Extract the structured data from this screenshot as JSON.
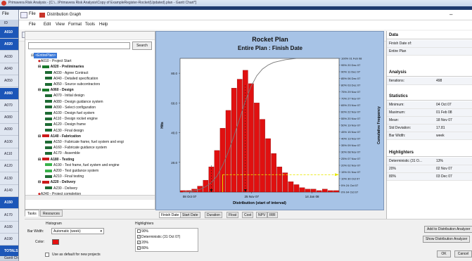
{
  "outer_title": "Primavera Risk Analysis - [C:\\...\\Primavera Risk Analysis\\Copy of ExampleRegister-Rocket(Updated).plan - Gantt Chart*]",
  "window": {
    "title": "Distribution Graph",
    "minimize": "–"
  },
  "menu": [
    "File",
    "Edit",
    "View",
    "Format",
    "Tools",
    "Help"
  ],
  "outer_tabs": {
    "file": "File"
  },
  "strip": {
    "header": "ID",
    "rows": [
      "A010",
      "A020",
      "A030",
      "A040",
      "A050",
      "A060",
      "A070",
      "A080",
      "A090",
      "A100",
      "A110",
      "A120",
      "A130",
      "A140",
      "A150",
      "A170",
      "A180",
      "A190",
      "TOTALS"
    ],
    "bottom_tab": "Gantt Ch"
  },
  "search": {
    "button": "Search",
    "value": ""
  },
  "tree": [
    {
      "label": "<EntirePlan>",
      "level": 0,
      "kind": "root"
    },
    {
      "label": "A010 - Project Start",
      "level": 1,
      "kind": "milestone"
    },
    {
      "label": "A020 - Preliminaries",
      "level": 1,
      "kind": "summary"
    },
    {
      "label": "A030 - Agree Contract",
      "level": 2,
      "kind": "task"
    },
    {
      "label": "A040 - Detailed specification",
      "level": 2,
      "kind": "task"
    },
    {
      "label": "A050 - Source subcontractors",
      "level": 2,
      "kind": "task"
    },
    {
      "label": "A060 - Design",
      "level": 1,
      "kind": "summary"
    },
    {
      "label": "A070 - Initial design",
      "level": 2,
      "kind": "task"
    },
    {
      "label": "A080 - Design guidance system",
      "level": 2,
      "kind": "task"
    },
    {
      "label": "A090 - Select configuration",
      "level": 2,
      "kind": "task"
    },
    {
      "label": "A100 - Design fuel system",
      "level": 2,
      "kind": "task"
    },
    {
      "label": "A110 - Design rocket engine",
      "level": 2,
      "kind": "task"
    },
    {
      "label": "A120 - Design frame",
      "level": 2,
      "kind": "task"
    },
    {
      "label": "A130 - Final design",
      "level": 2,
      "kind": "task"
    },
    {
      "label": "A140 - Fabrication",
      "level": 1,
      "kind": "summary-red"
    },
    {
      "label": "A150 - Fabricate frame, fuel system and engi",
      "level": 2,
      "kind": "task"
    },
    {
      "label": "A160 - Fabricate guidance system",
      "level": 2,
      "kind": "task"
    },
    {
      "label": "A170 - Assemble",
      "level": 2,
      "kind": "task"
    },
    {
      "label": "A180 - Testing",
      "level": 1,
      "kind": "summary-red"
    },
    {
      "label": "A190 - Test frame, fuel system and engine",
      "level": 2,
      "kind": "task-g"
    },
    {
      "label": "A200 - Test guidance system",
      "level": 2,
      "kind": "task-g"
    },
    {
      "label": "A210 - Final testing",
      "level": 2,
      "kind": "task"
    },
    {
      "label": "A220 - Delivery",
      "level": 1,
      "kind": "summary-red"
    },
    {
      "label": "A230 - Delivery",
      "level": 2,
      "kind": "task"
    },
    {
      "label": "A240 - Project completion",
      "level": 1,
      "kind": "milestone"
    }
  ],
  "panel_tabs": [
    "Tasks",
    "Resources"
  ],
  "chart_tabs": [
    "Finish Date",
    "Start Date",
    "Duration",
    "Float",
    "Cost",
    "NPV",
    "IRR"
  ],
  "colors": {
    "bar": "#e01010",
    "plot_bg": "#ffffff",
    "frame_bg": "#a7c3e6",
    "cum_line": "#777777",
    "highlight": "#e8e800"
  },
  "chart_data": {
    "type": "bar",
    "title": "Rocket Plan",
    "subtitle": "Entire Plan : Finish Date",
    "xlabel": "Distribution (start of interval)",
    "ylabel": "Hits",
    "y2label": "Cumulative Frequency",
    "ylim": [
      0,
      90
    ],
    "yticks": [
      "80.0",
      "60.0",
      "40.0",
      "20.0"
    ],
    "xticks": [
      "08 Oct 07",
      "25 Nov 07",
      "14 Jan 08"
    ],
    "values": [
      1,
      1,
      2,
      4,
      8,
      17,
      28,
      43,
      55,
      70,
      76,
      82,
      73,
      60,
      49,
      36,
      26,
      17,
      13,
      7,
      5,
      3,
      2,
      2,
      1,
      2,
      1,
      1
    ],
    "cumulative": [
      0,
      0,
      0.01,
      0.02,
      0.04,
      0.07,
      0.12,
      0.2,
      0.3,
      0.42,
      0.55,
      0.68,
      0.79,
      0.87,
      0.92,
      0.95,
      0.97,
      0.98,
      0.99,
      0.995,
      1,
      1,
      1,
      1,
      1,
      1,
      1,
      1
    ],
    "right_axis": [
      "100% 01 Feb 08",
      "95% 20 Dec 07",
      "90% 11 Dec 07",
      "85% 06 Dec 07",
      "80% 03 Dec 07",
      "75% 29 Nov 07",
      "70% 27 Nov 07",
      "65% 23 Nov 07",
      "60% 22 Nov 07",
      "55% 20 Nov 07",
      "50% 19 Nov 07",
      "45% 15 Nov 07",
      "40% 13 Nov 07",
      "35% 09 Nov 07",
      "30% 08 Nov 07",
      "25% 07 Nov 07",
      "20% 02 Nov 07",
      "15% 01 Nov 07",
      "10% 30 Oct 07",
      "5% 24 Oct 07",
      "0% 04 Oct 07"
    ]
  },
  "stats": {
    "data_h": "Data",
    "data": [
      [
        "Finish Date of:",
        ""
      ],
      [
        "Entire Plan",
        ""
      ]
    ],
    "analysis_h": "Analysis",
    "analysis": [
      [
        "Iterations:",
        "498"
      ]
    ],
    "statistics_h": "Statistics",
    "statistics": [
      [
        "Minimum:",
        "04 Oct 07"
      ],
      [
        "Maximum:",
        "01 Feb 08"
      ],
      [
        "Mean:",
        "18 Nov 07"
      ],
      [
        "Std Deviation:",
        "17.81"
      ],
      [
        "Bar Width:",
        "week"
      ]
    ],
    "highlighters_h": "Highlighters",
    "highlighters": [
      [
        "Deterministic (31 O...",
        "13%"
      ],
      [
        "20%",
        "02 Nov 07"
      ],
      [
        "80%",
        "03 Dec 07"
      ]
    ]
  },
  "bottom": {
    "histogram": "Histogram",
    "bar_width_label": "Bar Width:",
    "bar_width_value": "Automatic (week)",
    "color_label": "Color:",
    "default_label": "Use as default for new projects",
    "highlighters_label": "Highlighters",
    "hl_items": [
      "90%",
      "Deterministic (31 Oct 07)",
      "20%",
      "80%"
    ],
    "add_btn": "Add to Distribution Analyzer",
    "show_btn": "Show Distribution Analyzer",
    "ok": "OK",
    "cancel": "Cancel"
  }
}
